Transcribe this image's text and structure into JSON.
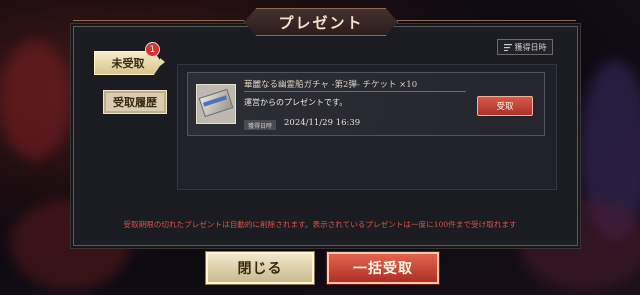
{
  "header": {
    "title": "プレゼント"
  },
  "tabs": [
    {
      "label": "未受取",
      "badge": "1",
      "active": true
    },
    {
      "label": "受取履歴",
      "active": false
    }
  ],
  "sort": {
    "icon": "sort-icon",
    "label": "獲得日時"
  },
  "items": [
    {
      "title": "華麗なる幽霊船ガチャ -第2弾- チケット ×10",
      "description": "運営からのプレゼントです。",
      "date_tag": "獲得日時",
      "date": "2024/11/29 16:39",
      "receive_label": "受取"
    }
  ],
  "notice": "受取期限の切れたプレゼントは自動的に削除されます。表示されているプレゼントは一度に100件まで受け取れます",
  "footer": {
    "close_label": "閉じる",
    "receive_all_label": "一括受取"
  },
  "colors": {
    "accent_red": "#c7402f",
    "panel": "#1b1c22",
    "cream": "#e9dcb6"
  }
}
